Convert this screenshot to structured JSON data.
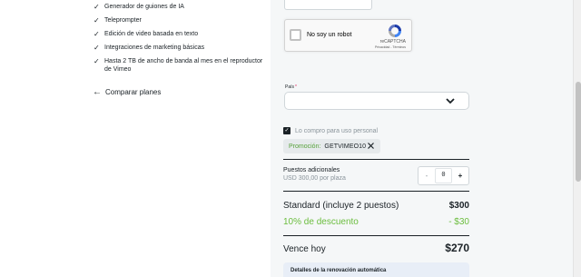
{
  "features": [
    "Generador de guiones de IA",
    "Teleprompter",
    "Edición de video basada en texto",
    "Integraciones de marketing básicas",
    "Hasta 2 TB de ancho de banda al mes en el reproductor de Vimeo"
  ],
  "compare_label": "Comparar planes",
  "recaptcha": {
    "label": "No soy un robot",
    "brand": "reCAPTCHA",
    "terms": "Privacidad - Términos"
  },
  "country": {
    "label": "País",
    "required_mark": "*",
    "value": ""
  },
  "personal_use": {
    "label": "Lo compro para uso personal",
    "checked": true
  },
  "promo": {
    "label": "Promoción:",
    "code": "GETVIMEO10"
  },
  "seats": {
    "title": "Puestos adicionales",
    "price": "USD 300,00 por plaza",
    "value": "0",
    "minus": "-",
    "plus": "+"
  },
  "summary": {
    "standard_label": "Standard (incluye 2 puestos)",
    "standard_amount": "$300",
    "discount_label": "10% de descuento",
    "discount_amount": "- $30",
    "due_label": "Vence hoy",
    "due_amount": "$270"
  },
  "renewal_label": "Detalles de la renovación automática",
  "colors": {
    "accent_green": "#6bbd3e",
    "text_dark": "#1a2126",
    "muted": "#8a949b",
    "panel_bg": "#f5f7f8"
  }
}
